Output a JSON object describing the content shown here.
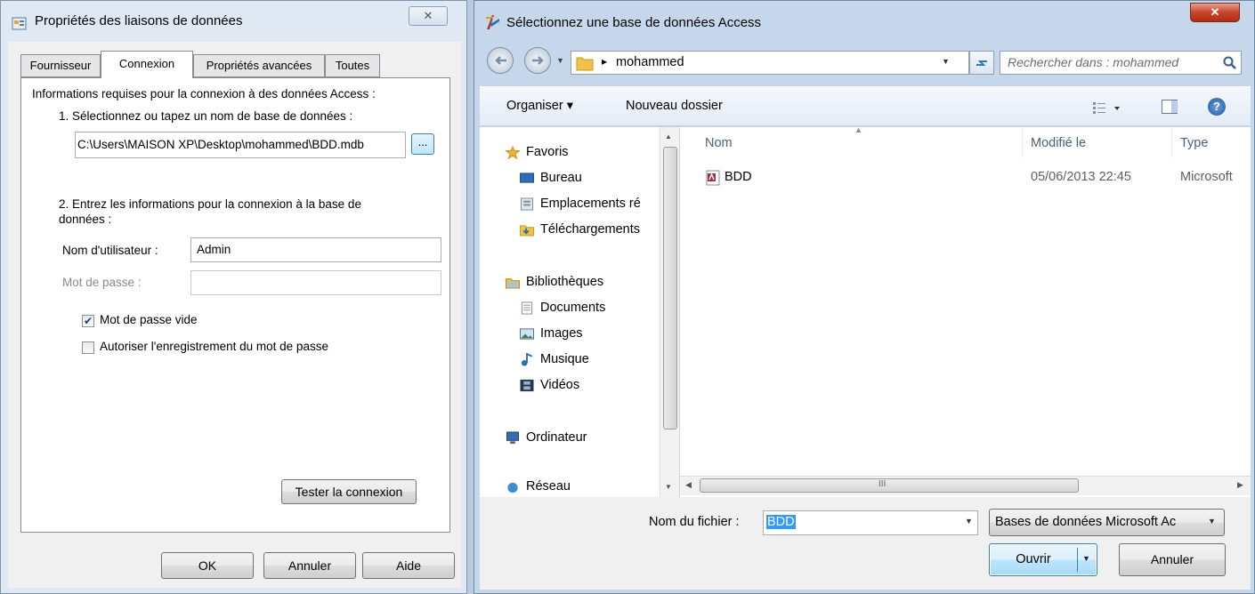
{
  "dlg1": {
    "title": "Propriétés des liaisons de données",
    "tabs": [
      "Fournisseur",
      "Connexion",
      "Propriétés avancées",
      "Toutes"
    ],
    "intro": "Informations requises pour la connexion à des données Access :",
    "step1": "1. Sélectionnez ou tapez un nom de base de données :",
    "db_path": "C:\\Users\\MAISON XP\\Desktop\\mohammed\\BDD.mdb",
    "browse_label": "...",
    "step2_line1": "2. Entrez les informations pour la connexion à la base de",
    "step2_line2": "données :",
    "user_label": "Nom d'utilisateur :",
    "user_value": "Admin",
    "pwd_label": "Mot de passe :",
    "pwd_value": "",
    "blank_pwd": "Mot de passe vide",
    "blank_pwd_checked": "✔",
    "save_pwd": "Autoriser l'enregistrement du mot de passe",
    "test_button": "Tester la connexion",
    "ok": "OK",
    "cancel": "Annuler",
    "help": "Aide",
    "close_glyph": "✕"
  },
  "dlg2": {
    "title": "Sélectionnez une base de données Access",
    "close_glyph": "✕",
    "path_arrow": "▸",
    "path": "mohammed",
    "search_placeholder": "Rechercher dans : mohammed",
    "organize": "Organiser ▾",
    "new_folder": "Nouveau dossier",
    "help_glyph": "?",
    "nav": {
      "favorites": "Favoris",
      "desktop": "Bureau",
      "recent": "Emplacements ré",
      "downloads": "Téléchargements",
      "libraries": "Bibliothèques",
      "documents": "Documents",
      "images": "Images",
      "music": "Musique",
      "videos": "Vidéos",
      "computer": "Ordinateur",
      "network": "Réseau"
    },
    "columns": {
      "name": "Nom",
      "modified": "Modifié le",
      "type": "Type"
    },
    "file": {
      "name": "BDD",
      "modified": "05/06/2013 22:45",
      "type": "Microsoft"
    },
    "filename_label": "Nom du fichier :",
    "filename_value": "BDD",
    "filter": "Bases de données Microsoft Ac",
    "open": "Ouvrir",
    "cancel": "Annuler",
    "hscroll_grip": "III"
  }
}
